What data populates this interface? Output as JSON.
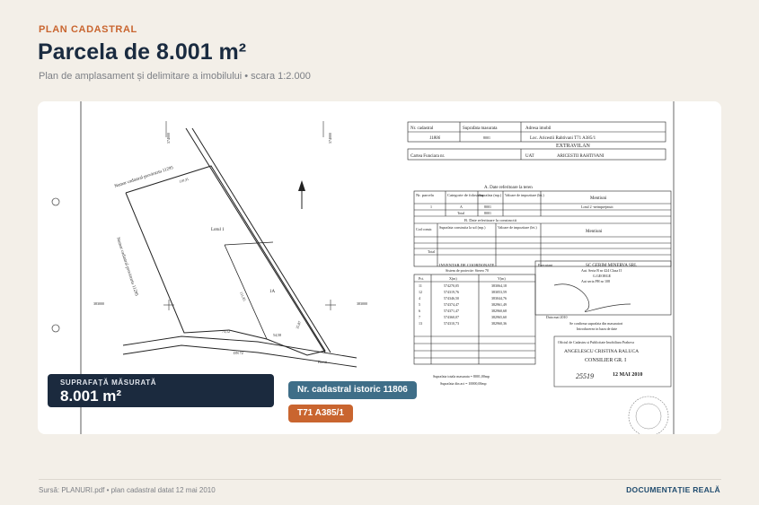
{
  "header": {
    "eyebrow": "PLAN CADASTRAL",
    "title": "Parcela de 8.001 m²",
    "subtitle": "Plan de amplasament și delimitare a imobilului • scara 1:2.000"
  },
  "document": {
    "plan": {
      "label_top_left": "Numar cadastral proviozriu 11295",
      "label_left": "Numar cadastral provizoriu 11295",
      "lot1": "Lotul 1",
      "lot1a": "1A",
      "road": "DN 72",
      "road2": "Pitesti",
      "dist1": "110,31",
      "dist2": "111,85",
      "dist3": "73,12",
      "dist4": "54,58",
      "dist5": "35,87",
      "coord_left": "383000",
      "coord_right": "383000",
      "coord_top_left": "574000",
      "coord_top_right": "574000"
    },
    "top_table": {
      "h1": "Nr. cadastral",
      "h2": "Suprafata masurata",
      "h3": "Adresa imobil",
      "v1": "11806",
      "v2": "8001",
      "v3": "Loc. Aricestii Rahtivani T71 A385/1",
      "extravilan": "EXTRAVILAN",
      "cf": "Cartea Funciara nr.",
      "uat": "UAT",
      "uat_val": "ARICESTII RAHTIVANI"
    },
    "section_a": "A. Date referitoare la teren",
    "section_a_headers": [
      "Nr. parcela",
      "Categorie de folosinta",
      "Suprafata (mp.)",
      "Valoare de impozitare (lei.)",
      "Mentiuni"
    ],
    "section_a_row": [
      "1",
      "A",
      "8001",
      "",
      "Lotul 2 -neimprejmuit"
    ],
    "section_a_total": [
      "Total",
      "8001"
    ],
    "section_b": "B. Date referitoare la constructii",
    "section_b_headers": [
      "Cod constr.",
      "Suprafata construita la sol (mp.)",
      "Valoare de impozitare (lei.)",
      "Mentiuni"
    ],
    "section_b_total": "Total",
    "coords": {
      "title": "INVENTAR DE COORDONATE",
      "subtitle": "Sistem de proiectie: Stereo 70",
      "headers": [
        "Pct.",
        "X(m)",
        "Y(m)"
      ],
      "rows": [
        [
          "11",
          "574270,05",
          "383064,18"
        ],
        [
          "12",
          "574319,76",
          "383053,59"
        ],
        [
          "4",
          "574346,50",
          "383044,76"
        ],
        [
          "5",
          "574374,47",
          "382961,49"
        ],
        [
          "6",
          "574371,47",
          "382960,68"
        ],
        [
          "7",
          "574360,07",
          "382965,60"
        ],
        [
          "13",
          "574310,73",
          "382960,36"
        ]
      ],
      "area_measured": "Suprafata totala masurata = 8001,00mp",
      "area_act": "Suprafata din act = 10000,00mp"
    },
    "executant": {
      "label": "Executant",
      "company": "SC GERIM MINERVA SRL",
      "cert": "Aut. Seria B nr 424 Clasa II",
      "name": "G.GEORGE",
      "cert2": "Aut seria PH nr 108",
      "date": "Data mai 2010",
      "confirm": "Se confirma suprafata din masuratori",
      "confirm2": "Introducerea in baza de date",
      "office": "Oficiul de Cadastru si Publicitate Imobiliara Prahova",
      "person": "ANGELESCU CRISTINA RALUCA",
      "role": "CONSILIER GR. I",
      "stamp_no": "25519",
      "stamp_date": "12 MAI 2010"
    }
  },
  "area_box": {
    "label": "SUPRAFAȚĂ MĂSURATĂ",
    "value": "8.001 m²"
  },
  "chips": {
    "cadastral": "Nr. cadastral istoric 11806",
    "tarla": "T71 A385/1"
  },
  "footer": {
    "source": "Sursă: PLANURI.pdf • plan cadastral datat 12 mai 2010",
    "badge": "DOCUMENTAȚIE REALĂ"
  },
  "colors": {
    "accent": "#c9652f",
    "navy": "#1b2a3e",
    "chip_blue": "#3f6e88",
    "background": "#f3efe8"
  }
}
